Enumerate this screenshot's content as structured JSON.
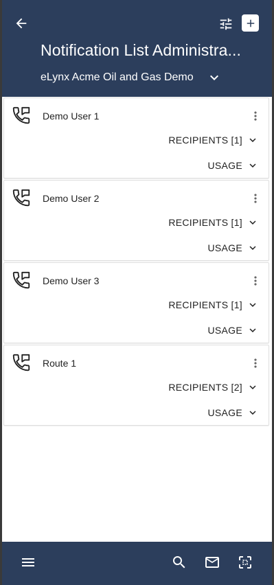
{
  "header": {
    "title": "Notification List Administra...",
    "org_name": "eLynx Acme Oil and Gas Demo"
  },
  "colors": {
    "header_bg": "#2c3e5c",
    "text_dark": "#222222"
  },
  "icons": {
    "back": "arrow-left-icon",
    "filter": "tune-sliders-icon",
    "add": "plus-box-icon",
    "card_type": "phone-forward-icon",
    "more": "dots-vertical-icon",
    "expand": "chevron-down-icon",
    "menu": "hamburger-menu-icon",
    "search": "search-icon",
    "mail": "mail-icon",
    "fullscreen": "fullscreen-icon"
  },
  "lists": [
    {
      "name": "Demo User 1",
      "recipients_label": "RECIPIENTS [1]",
      "usage_label": "USAGE"
    },
    {
      "name": "Demo User 2",
      "recipients_label": "RECIPIENTS [1]",
      "usage_label": "USAGE"
    },
    {
      "name": "Demo User 3",
      "recipients_label": "RECIPIENTS [1]",
      "usage_label": "USAGE"
    },
    {
      "name": "Route 1",
      "recipients_label": "RECIPIENTS [2]",
      "usage_label": "USAGE"
    }
  ]
}
